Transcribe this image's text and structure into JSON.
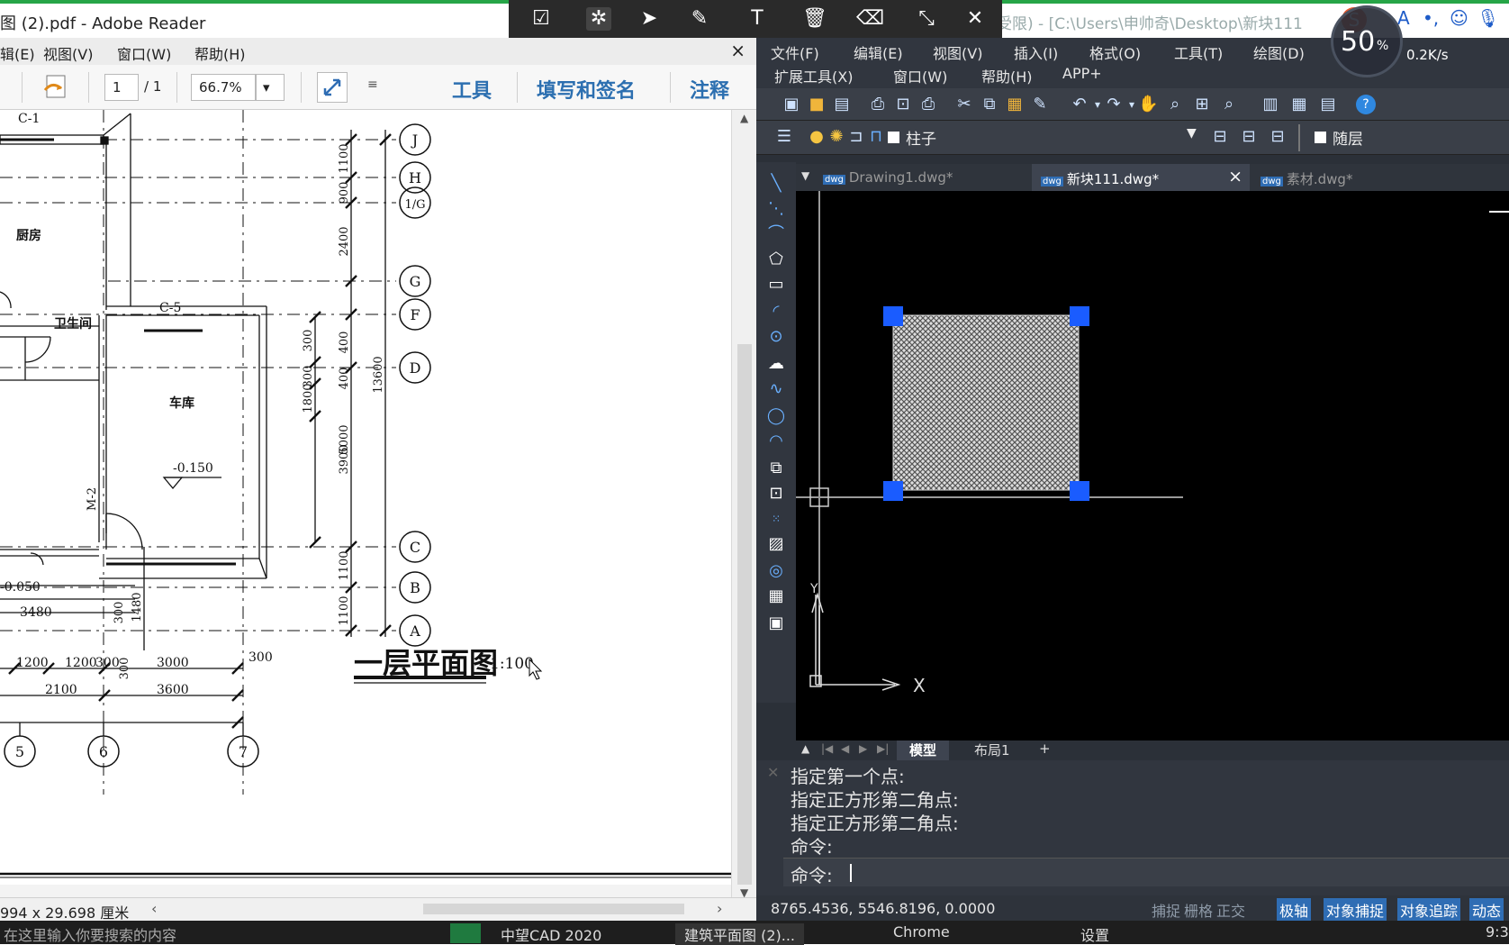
{
  "reader": {
    "title": "图 (2).pdf - Adobe Reader",
    "menu": [
      "辑(E)",
      "视图(V)",
      "窗口(W)",
      "帮助(H)"
    ],
    "close": "×",
    "page_current": "1",
    "page_total": "/ 1",
    "zoom": "66.7%",
    "links": [
      "工具",
      "填写和签名",
      "注释"
    ],
    "status_size": "994 x 29.698 厘米",
    "plan": {
      "axis_letters": [
        "J",
        "H",
        "1/G",
        "G",
        "F",
        "D",
        "C",
        "B",
        "A"
      ],
      "axis_numbers": [
        "5",
        "6",
        "7"
      ],
      "rooms": [
        "厨房",
        "卫生间",
        "车库"
      ],
      "window_labels": [
        "C-1",
        "C-5"
      ],
      "door_label": "M-2",
      "elevations": [
        "-0.150",
        "-0.050"
      ],
      "dims_vertical_outer": [
        "1100",
        "900",
        "2400",
        "3900",
        "1100",
        "1100"
      ],
      "dims_vertical_inner": [
        "300",
        "400",
        "300",
        "400",
        "1800",
        "5000"
      ],
      "dim_total": "13600",
      "dims_bottom_row1": [
        "1200",
        "1200",
        "300",
        "3000",
        "300"
      ],
      "dims_bottom_row2": [
        "2100",
        "3600"
      ],
      "dim_3480": "3480",
      "dims_small": [
        "300",
        "1480",
        "300"
      ],
      "plan_title": "一层平面图",
      "plan_scale": "1:100"
    }
  },
  "cad": {
    "title": "能受限) - [C:\\Users\\申帅奇\\Desktop\\新块111",
    "menu_row1": [
      "文件(F)",
      "编辑(E)",
      "视图(V)",
      "插入(I)",
      "格式(O)",
      "工具(T)",
      "绘图(D)"
    ],
    "menu_row2": [
      "扩展工具(X)",
      "窗口(W)",
      "帮助(H)",
      "APP+"
    ],
    "layer_name": "柱子",
    "linetype": "随层",
    "tabs": [
      "Drawing1.dwg*",
      "新块111.dwg*",
      "素材.dwg*"
    ],
    "tab_close": "×",
    "layout_tabs": [
      "模型",
      "布局1",
      "+"
    ],
    "commands": [
      "指定第一个点:",
      "指定正方形第二角点:",
      "指定正方形第二角点:",
      "命令:",
      "命令:"
    ],
    "coords": "8765.4536, 5546.8196, 0.0000",
    "status_buttons": [
      {
        "label": "捕捉",
        "on": false
      },
      {
        "label": "栅格",
        "on": false
      },
      {
        "label": "正交",
        "on": false
      },
      {
        "label": "极轴",
        "on": true
      },
      {
        "label": "对象捕捉",
        "on": true
      },
      {
        "label": "对象追踪",
        "on": true
      },
      {
        "label": "动态",
        "on": true
      }
    ],
    "ucs_x": "X",
    "ucs_y": "Y"
  },
  "netmeter": {
    "percent": "50",
    "percent_sign": "%",
    "speed": "0.2K/s"
  },
  "taskbar": {
    "items": [
      "在这里输入你要搜索的内容",
      "中望CAD 2020",
      "建筑平面图 (2)...",
      "Chrome",
      "设置"
    ],
    "clock": "9:3"
  },
  "colors": {
    "cad_bg": "#000000",
    "grip": "#1a5cff",
    "accent_blue": "#2f6db4",
    "title_green": "#26a547"
  }
}
